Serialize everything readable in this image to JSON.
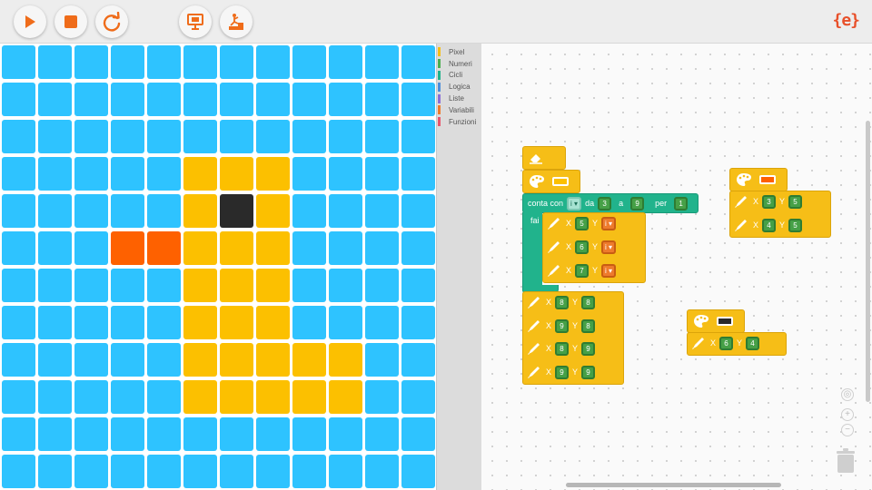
{
  "toolbar": {
    "buttons": [
      {
        "name": "run-button",
        "icon": "play-icon",
        "color": "#ef6c1a"
      },
      {
        "name": "stop-button",
        "icon": "stop-icon",
        "color": "#ef6c1a"
      },
      {
        "name": "reset-button",
        "icon": "refresh-icon",
        "color": "#ef6c1a"
      },
      {
        "name": "present-button",
        "icon": "presentation-icon",
        "color": "#ef6c1a"
      },
      {
        "name": "challenge-button",
        "icon": "podium-icon",
        "color": "#ef6c1a"
      }
    ],
    "logo": "{e}"
  },
  "colors": {
    "blue": "#2ec3ff",
    "yellow": "#fcc000",
    "orange": "#fe6100",
    "black": "#2a2a2a",
    "accent": "#ef6c1a",
    "block_yellow": "#f6be17",
    "block_green": "#21b38c"
  },
  "pixel_grid": {
    "rows": 12,
    "cols": 12,
    "cells": [
      "BBBBBBBBBBBB",
      "BBBBBBBBBBBB",
      "BBBBBBBBBBBB",
      "BBBBBYYYBBBB",
      "BBBBBYKYBBBB",
      "BBBOOYYYBBBB",
      "BBBBBYYYBBBB",
      "BBBBBYYYBBBB",
      "BBBBBYYYYYBB",
      "BBBBBYYYYYBB",
      "BBBBBBBBBBBB",
      "BBBBBBBBBBBB"
    ]
  },
  "categories": [
    {
      "label": "Pixel",
      "color": "#f6be17"
    },
    {
      "label": "Numeri",
      "color": "#4caf50"
    },
    {
      "label": "Cicli",
      "color": "#21b38c"
    },
    {
      "label": "Logica",
      "color": "#4f8fdb"
    },
    {
      "label": "Liste",
      "color": "#8c6fd6"
    },
    {
      "label": "Variabili",
      "color": "#ee7b2c"
    },
    {
      "label": "Funzioni",
      "color": "#e8556c"
    }
  ],
  "blocks": {
    "loop": {
      "label_for": "conta con",
      "var": "i",
      "label_from": "da",
      "from": "3",
      "label_to": "a",
      "to": "9",
      "label_step": "per",
      "step": "1",
      "label_do": "fai"
    },
    "loop_body": [
      {
        "x": "5",
        "y": "i"
      },
      {
        "x": "6",
        "y": "i"
      },
      {
        "x": "7",
        "y": "i"
      }
    ],
    "after_loop": [
      {
        "x": "8",
        "y": "8"
      },
      {
        "x": "9",
        "y": "8"
      },
      {
        "x": "8",
        "y": "9"
      },
      {
        "x": "9",
        "y": "9"
      }
    ],
    "group_orange": [
      {
        "x": "3",
        "y": "5"
      },
      {
        "x": "4",
        "y": "5"
      }
    ],
    "group_black": [
      {
        "x": "6",
        "y": "4"
      }
    ],
    "x_label": "X",
    "y_label": "Y"
  }
}
